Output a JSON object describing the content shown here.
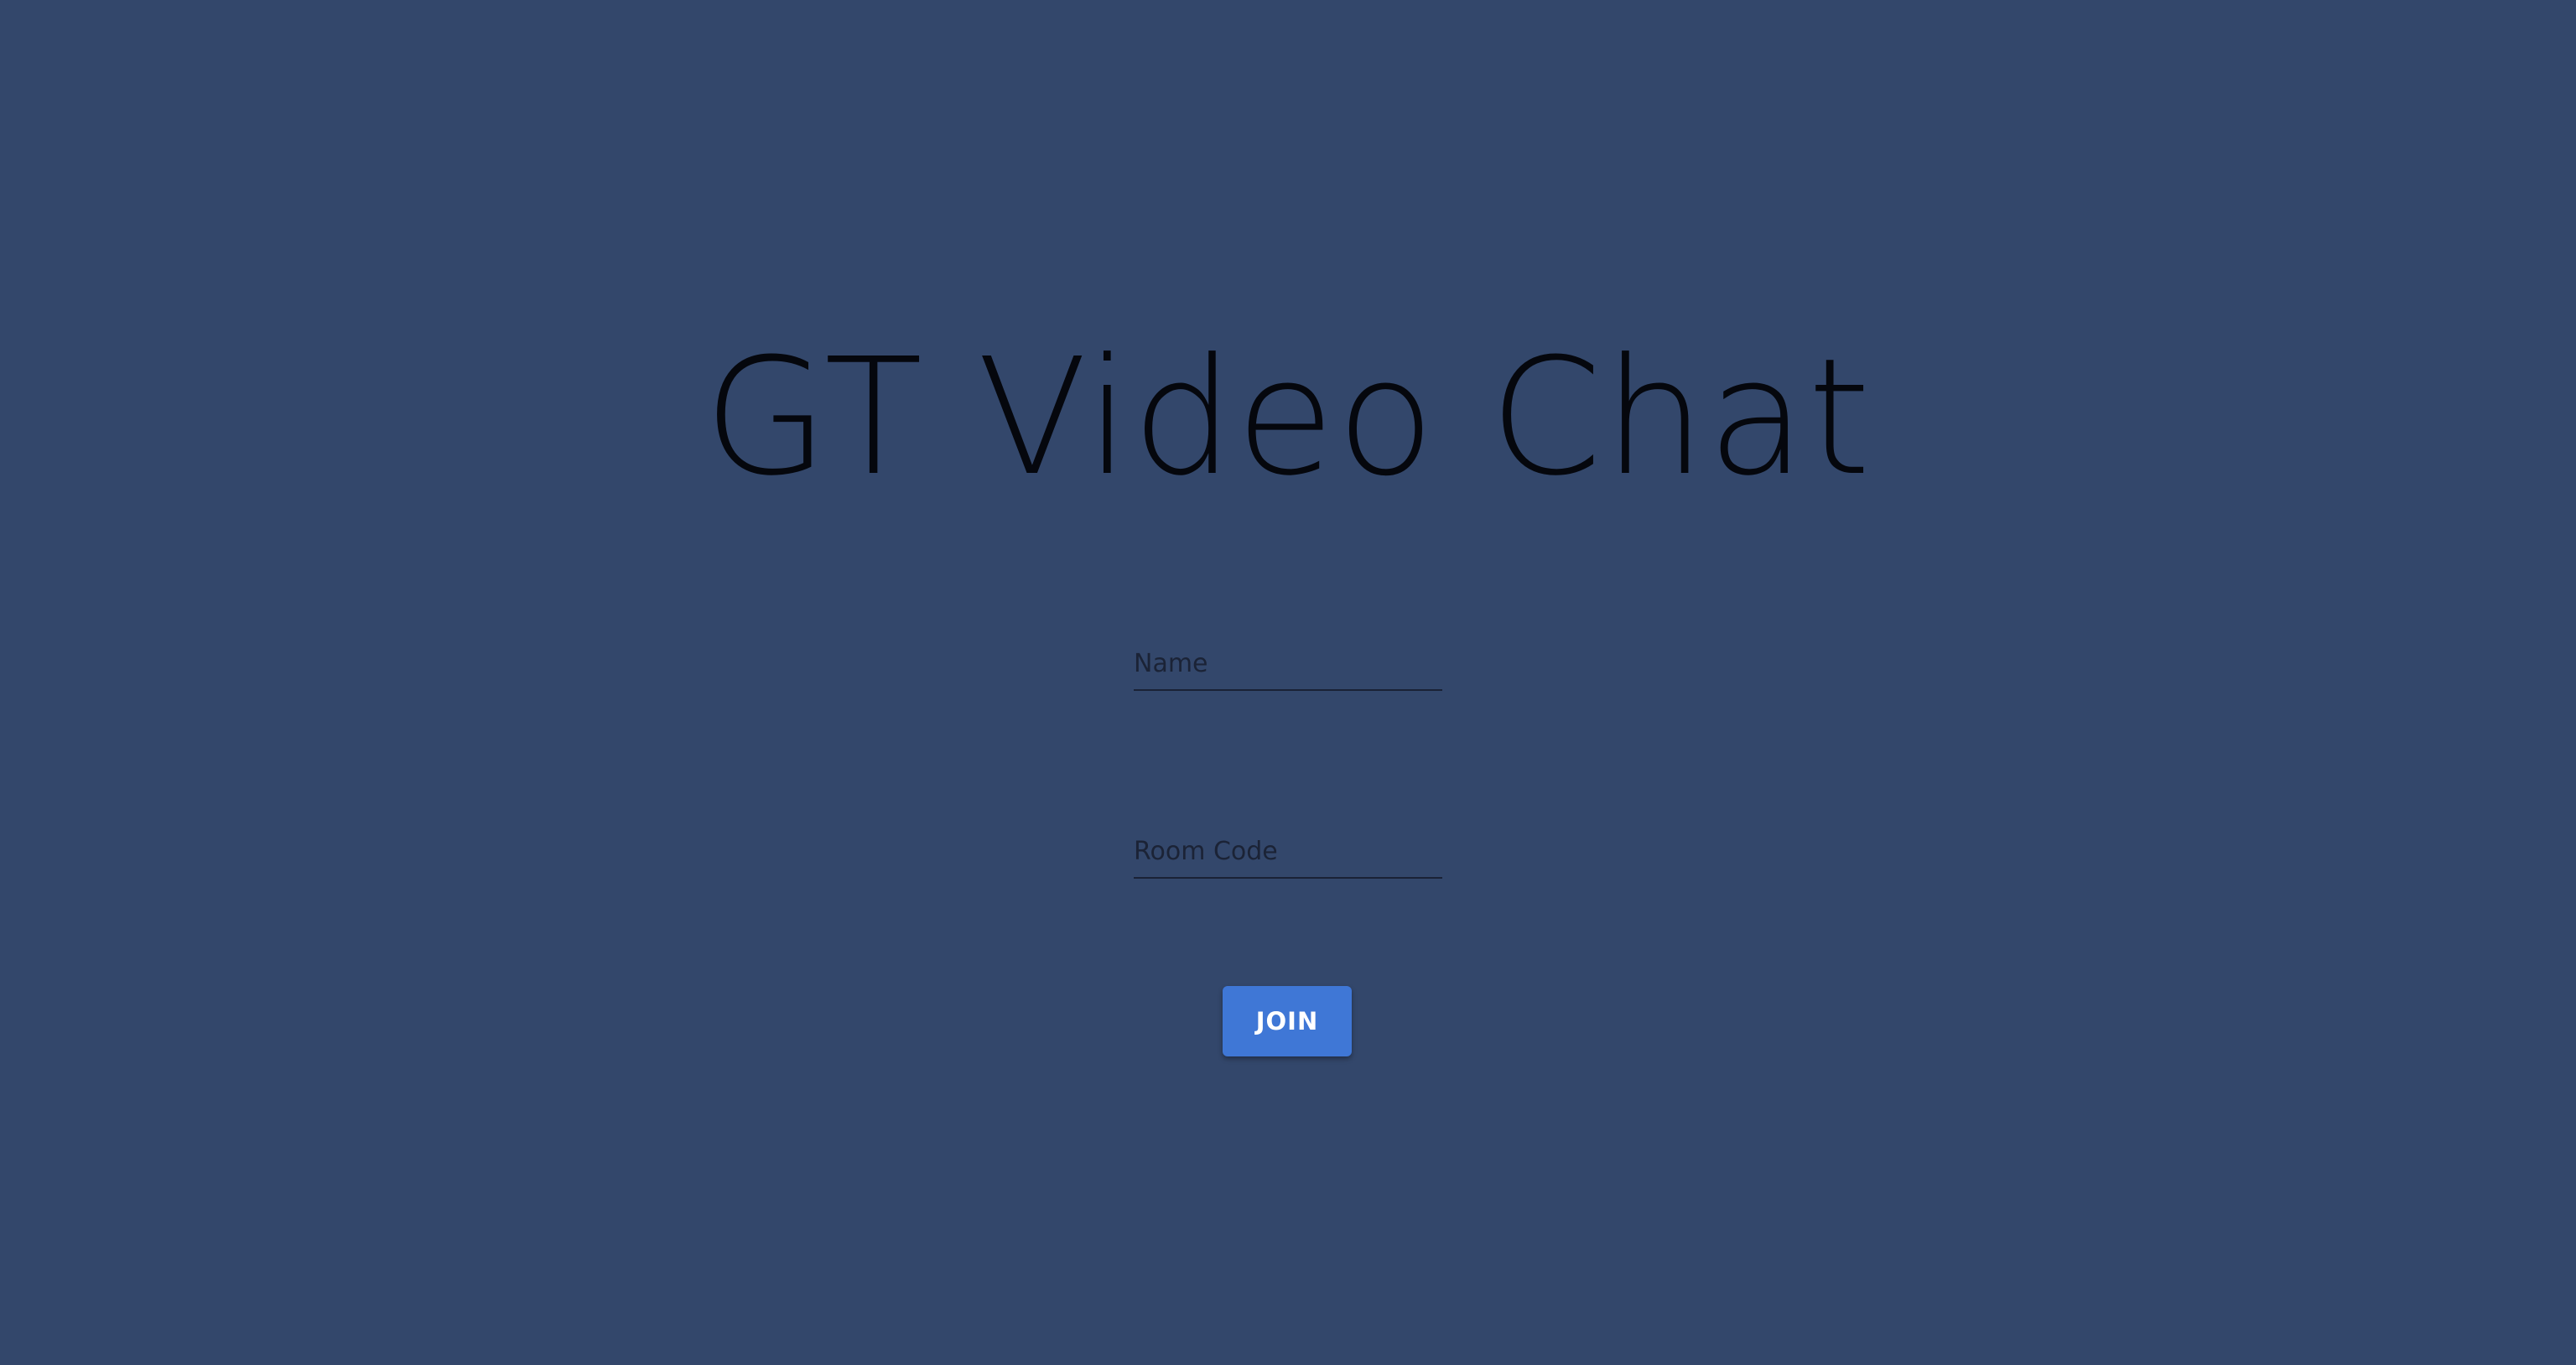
{
  "app": {
    "title": "GT Video Chat"
  },
  "form": {
    "name_placeholder": "Name",
    "name_value": "",
    "room_placeholder": "Room Code",
    "room_value": "",
    "join_label": "JOIN"
  },
  "colors": {
    "background": "#33476b",
    "title_text": "#05070d",
    "join_button": "#3f77d6"
  }
}
